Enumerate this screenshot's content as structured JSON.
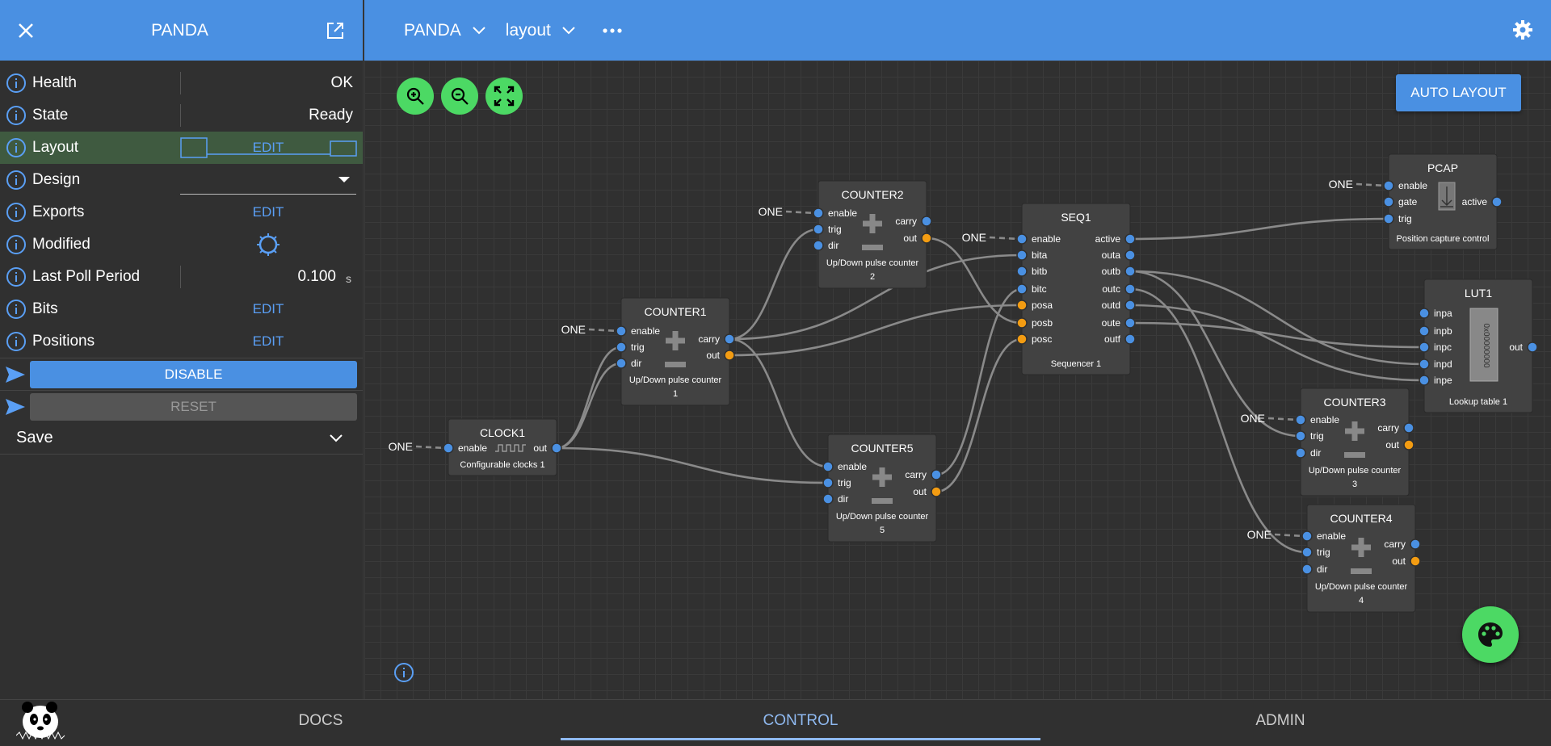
{
  "left_panel": {
    "title": "PANDA",
    "rows": [
      {
        "label": "Health",
        "value": "OK"
      },
      {
        "label": "State",
        "value": "Ready"
      },
      {
        "label": "Layout",
        "value": "EDIT"
      },
      {
        "label": "Design",
        "value": ""
      },
      {
        "label": "Exports",
        "value": "EDIT"
      },
      {
        "label": "Modified",
        "value": ""
      },
      {
        "label": "Last Poll Period",
        "value": "0.100",
        "unit": "s"
      },
      {
        "label": "Bits",
        "value": "EDIT"
      },
      {
        "label": "Positions",
        "value": "EDIT"
      }
    ],
    "disable_label": "DISABLE",
    "reset_label": "RESET",
    "save_label": "Save"
  },
  "top_bar": {
    "crumb1": "PANDA",
    "crumb2": "layout"
  },
  "canvas": {
    "auto_layout_label": "AUTO LAYOUT",
    "blocks": {
      "clock1": {
        "title": "CLOCK1",
        "desc": "Configurable clocks 1",
        "in": [
          "enable"
        ],
        "out": [
          "out"
        ]
      },
      "counter1": {
        "title": "COUNTER1",
        "desc": "Up/Down pulse counter 1",
        "in": [
          "enable",
          "trig",
          "dir"
        ],
        "out": [
          "carry",
          "out"
        ]
      },
      "counter2": {
        "title": "COUNTER2",
        "desc": "Up/Down pulse counter 2",
        "in": [
          "enable",
          "trig",
          "dir"
        ],
        "out": [
          "carry",
          "out"
        ]
      },
      "counter5": {
        "title": "COUNTER5",
        "desc": "Up/Down pulse counter 5",
        "in": [
          "enable",
          "trig",
          "dir"
        ],
        "out": [
          "carry",
          "out"
        ]
      },
      "seq1": {
        "title": "SEQ1",
        "desc": "Sequencer 1",
        "in": [
          "enable",
          "bita",
          "bitb",
          "bitc",
          "posa",
          "posb",
          "posc"
        ],
        "out": [
          "active",
          "outa",
          "outb",
          "outc",
          "outd",
          "oute",
          "outf"
        ]
      },
      "pcap": {
        "title": "PCAP",
        "desc": "Position capture control",
        "in": [
          "enable",
          "gate",
          "trig"
        ],
        "out": [
          "active"
        ]
      },
      "lut1": {
        "title": "LUT1",
        "desc": "Lookup table 1",
        "in": [
          "inpa",
          "inpb",
          "inpc",
          "inpd",
          "inpe"
        ],
        "out": [
          "out"
        ],
        "body_text": "0x00000000"
      },
      "counter3": {
        "title": "COUNTER3",
        "desc": "Up/Down pulse counter 3",
        "in": [
          "enable",
          "trig",
          "dir"
        ],
        "out": [
          "carry",
          "out"
        ]
      },
      "counter4": {
        "title": "COUNTER4",
        "desc": "Up/Down pulse counter 4",
        "in": [
          "enable",
          "trig",
          "dir"
        ],
        "out": [
          "carry",
          "out"
        ]
      }
    },
    "one_label": "ONE"
  },
  "bottom_tabs": [
    "DOCS",
    "CONTROL",
    "ADMIN"
  ],
  "colors": {
    "accent": "#4a90e2",
    "green": "#4cd964",
    "port_bit": "#4a90e2",
    "port_pos": "#f39c12"
  }
}
